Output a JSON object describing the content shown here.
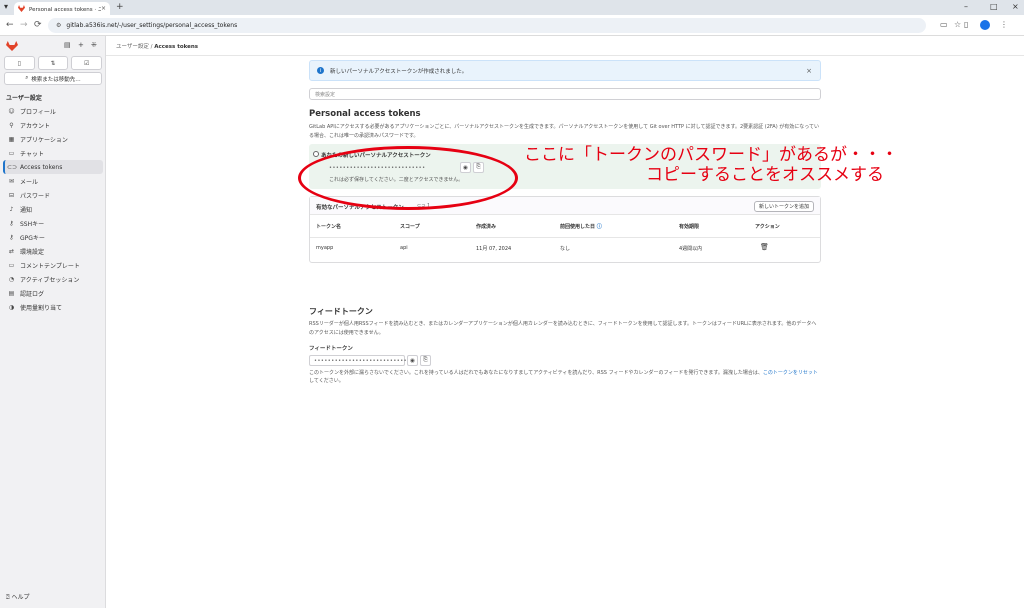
{
  "browser": {
    "tab_title": "Personal access tokens · ユーザー設定",
    "url": "gitlab.a536is.net/-/user_settings/personal_access_tokens"
  },
  "sidebar": {
    "search_label": "検索または移動先…",
    "heading": "ユーザー設定",
    "items": [
      {
        "label": "プロフィール",
        "icon": "profile-icon"
      },
      {
        "label": "アカウント",
        "icon": "account-icon"
      },
      {
        "label": "アプリケーション",
        "icon": "applications-icon"
      },
      {
        "label": "チャット",
        "icon": "chat-icon"
      },
      {
        "label": "Access tokens",
        "icon": "token-icon"
      },
      {
        "label": "メール",
        "icon": "mail-icon"
      },
      {
        "label": "パスワード",
        "icon": "password-icon"
      },
      {
        "label": "通知",
        "icon": "bell-icon"
      },
      {
        "label": "SSHキー",
        "icon": "key-icon"
      },
      {
        "label": "GPGキー",
        "icon": "key-icon"
      },
      {
        "label": "環境設定",
        "icon": "preferences-icon"
      },
      {
        "label": "コメントテンプレート",
        "icon": "comment-icon"
      },
      {
        "label": "アクティブセッション",
        "icon": "session-icon"
      },
      {
        "label": "認証ログ",
        "icon": "log-icon"
      },
      {
        "label": "使用量割り当て",
        "icon": "quota-icon"
      }
    ],
    "help": "ヘルプ"
  },
  "breadcrumb": {
    "parent": "ユーザー設定",
    "separator": "/",
    "current": "Access tokens"
  },
  "alert": {
    "message": "新しいパーソナルアクセストークンが作成されました。"
  },
  "search_settings_placeholder": "検索設定",
  "section": {
    "title": "Personal access tokens",
    "description": "GitLab APIにアクセスする必要があるアプリケーションごとに、パーソナルアクセストークンを生成できます。パーソナルアクセストークンを使用して Git over HTTP に対して認証できます。2要素認証 (2FA) が有効になっている場合、これは唯一の承認済みパスワードです。"
  },
  "new_token": {
    "label": "あなたの新しいパーソナルアクセストークン",
    "masked_value": "••••••••••••••••••••••••••••",
    "note": "これは必ず保存してください。二度とアクセスできません。"
  },
  "annotation": {
    "line1": "ここに「トークンのパスワード」があるが・・・",
    "line2": "コピーすることをオススメする"
  },
  "active_tokens": {
    "title": "有効なパーソナルアクセストークン",
    "count": "1",
    "add_button": "新しいトークンを追加",
    "columns": [
      "トークン名",
      "スコープ",
      "作成済み",
      "前回使用した日",
      "有効期限",
      "アクション"
    ],
    "rows": [
      {
        "name": "myapp",
        "scope": "api",
        "created": "11月 07, 2024",
        "last_used": "なし",
        "expires": "4週間以内"
      }
    ]
  },
  "feed": {
    "title": "フィードトークン",
    "description": "RSSリーダーが個人用RSSフィードを読み込むとき、またはカレンダーアプリケーションが個人用カレンダーを読み込むときに、フィードトークンを使用して認証します。トークンはフィードURLに表示されます。他のデータへのアクセスには使用できません。",
    "label": "フィードトークン",
    "masked_value": "••••••••••••••••••••••••••••",
    "note_prefix": "このトークンを外部に漏らさないでください。これを持っている人はだれでもあなたになりすましてアクティビティを読んだり、RSS フィードやカレンダーのフィードを発行できます。漏洩した場合は、",
    "reset_link": "このトークンをリセット",
    "note_suffix": "してください。"
  },
  "colors": {
    "annotation_red": "#e60012",
    "accent_blue": "#1f75cb",
    "success_bg": "#ecf4ee"
  }
}
